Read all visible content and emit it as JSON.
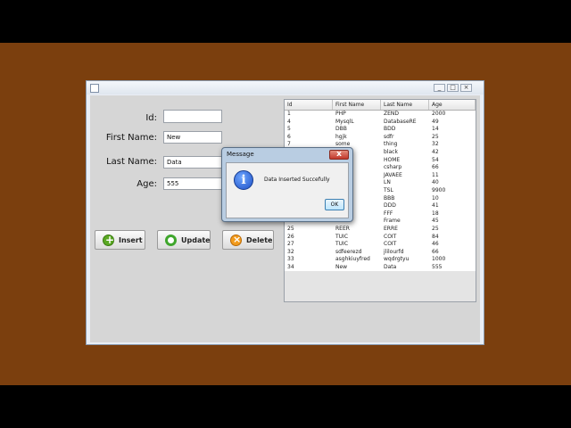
{
  "window": {
    "controls": {
      "minimize": "_",
      "maximize": "□",
      "close": "×"
    }
  },
  "form": {
    "id_label": "Id:",
    "first_name_label": "First Name:",
    "last_name_label": "Last Name:",
    "age_label": "Age:",
    "id_value": "",
    "first_name_value": "New",
    "last_name_value": "Data",
    "age_value": "555"
  },
  "buttons": {
    "insert": "Insert",
    "update": "Update",
    "delete": "Delete"
  },
  "table": {
    "headers": [
      "Id",
      "First Name",
      "Last Name",
      "Age"
    ],
    "rows": [
      [
        "1",
        "PHP",
        "ZEND",
        "2000"
      ],
      [
        "4",
        "MysqlL",
        "DatabaseRE",
        "49"
      ],
      [
        "5",
        "DBB",
        "BDD",
        "14"
      ],
      [
        "6",
        "hgjk",
        "sdfr",
        "25"
      ],
      [
        "7",
        "some",
        "thing",
        "32"
      ],
      [
        "",
        "",
        "black",
        "42"
      ],
      [
        "",
        "",
        "HOME",
        "54"
      ],
      [
        "",
        "",
        "csharp",
        "66"
      ],
      [
        "",
        "",
        "JAVAEE",
        "11"
      ],
      [
        "",
        "",
        "LN",
        "40"
      ],
      [
        "",
        "",
        "TSL",
        "9900"
      ],
      [
        "",
        "",
        "BBB",
        "10"
      ],
      [
        "",
        "",
        "DDD",
        "41"
      ],
      [
        "",
        "",
        "FFF",
        "18"
      ],
      [
        "",
        "",
        "Frame",
        "45"
      ],
      [
        "25",
        "REER",
        "ERRE",
        "25"
      ],
      [
        "26",
        "TUIC",
        "COIT",
        "84"
      ],
      [
        "27",
        "TUIC",
        "COIT",
        "46"
      ],
      [
        "32",
        "sdfeerezd",
        "jlilourfd",
        "66"
      ],
      [
        "33",
        "asghkiuyfred",
        "wqdrgtyu",
        "1000"
      ],
      [
        "34",
        "New",
        "Data",
        "555"
      ]
    ]
  },
  "dialog": {
    "title": "Message",
    "message": "Data Inserted Succefully",
    "ok_label": "OK",
    "close_glyph": "x",
    "icon_glyph": "i"
  }
}
